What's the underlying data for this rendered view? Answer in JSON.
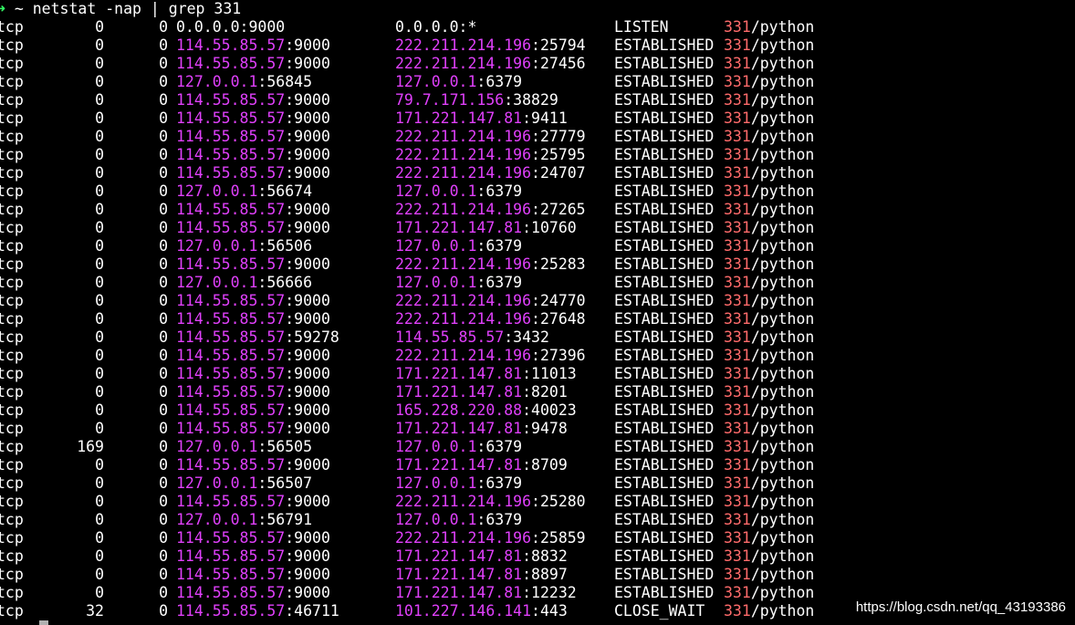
{
  "prompt": {
    "arrow": "➜",
    "cwd": "~",
    "command": "netstat -nap | grep 331"
  },
  "rows": [
    {
      "proto": "tcp",
      "recv": "0",
      "send": "0",
      "local_ip": "0.0.0.0",
      "local_port": "9000",
      "foreign_ip": "0.0.0.0",
      "foreign_port": "*",
      "state": "LISTEN",
      "pid": "331",
      "prog": "/python",
      "colored": false
    },
    {
      "proto": "tcp",
      "recv": "0",
      "send": "0",
      "local_ip": "114.55.85.57",
      "local_port": "9000",
      "foreign_ip": "222.211.214.196",
      "foreign_port": "25794",
      "state": "ESTABLISHED",
      "pid": "331",
      "prog": "/python",
      "colored": true
    },
    {
      "proto": "tcp",
      "recv": "0",
      "send": "0",
      "local_ip": "114.55.85.57",
      "local_port": "9000",
      "foreign_ip": "222.211.214.196",
      "foreign_port": "27456",
      "state": "ESTABLISHED",
      "pid": "331",
      "prog": "/python",
      "colored": true
    },
    {
      "proto": "tcp",
      "recv": "0",
      "send": "0",
      "local_ip": "127.0.0.1",
      "local_port": "56845",
      "foreign_ip": "127.0.0.1",
      "foreign_port": "6379",
      "state": "ESTABLISHED",
      "pid": "331",
      "prog": "/python",
      "colored": true
    },
    {
      "proto": "tcp",
      "recv": "0",
      "send": "0",
      "local_ip": "114.55.85.57",
      "local_port": "9000",
      "foreign_ip": "79.7.171.156",
      "foreign_port": "38829",
      "state": "ESTABLISHED",
      "pid": "331",
      "prog": "/python",
      "colored": true
    },
    {
      "proto": "tcp",
      "recv": "0",
      "send": "0",
      "local_ip": "114.55.85.57",
      "local_port": "9000",
      "foreign_ip": "171.221.147.81",
      "foreign_port": "9411",
      "state": "ESTABLISHED",
      "pid": "331",
      "prog": "/python",
      "colored": true
    },
    {
      "proto": "tcp",
      "recv": "0",
      "send": "0",
      "local_ip": "114.55.85.57",
      "local_port": "9000",
      "foreign_ip": "222.211.214.196",
      "foreign_port": "27779",
      "state": "ESTABLISHED",
      "pid": "331",
      "prog": "/python",
      "colored": true
    },
    {
      "proto": "tcp",
      "recv": "0",
      "send": "0",
      "local_ip": "114.55.85.57",
      "local_port": "9000",
      "foreign_ip": "222.211.214.196",
      "foreign_port": "25795",
      "state": "ESTABLISHED",
      "pid": "331",
      "prog": "/python",
      "colored": true
    },
    {
      "proto": "tcp",
      "recv": "0",
      "send": "0",
      "local_ip": "114.55.85.57",
      "local_port": "9000",
      "foreign_ip": "222.211.214.196",
      "foreign_port": "24707",
      "state": "ESTABLISHED",
      "pid": "331",
      "prog": "/python",
      "colored": true
    },
    {
      "proto": "tcp",
      "recv": "0",
      "send": "0",
      "local_ip": "127.0.0.1",
      "local_port": "56674",
      "foreign_ip": "127.0.0.1",
      "foreign_port": "6379",
      "state": "ESTABLISHED",
      "pid": "331",
      "prog": "/python",
      "colored": true
    },
    {
      "proto": "tcp",
      "recv": "0",
      "send": "0",
      "local_ip": "114.55.85.57",
      "local_port": "9000",
      "foreign_ip": "222.211.214.196",
      "foreign_port": "27265",
      "state": "ESTABLISHED",
      "pid": "331",
      "prog": "/python",
      "colored": true
    },
    {
      "proto": "tcp",
      "recv": "0",
      "send": "0",
      "local_ip": "114.55.85.57",
      "local_port": "9000",
      "foreign_ip": "171.221.147.81",
      "foreign_port": "10760",
      "state": "ESTABLISHED",
      "pid": "331",
      "prog": "/python",
      "colored": true
    },
    {
      "proto": "tcp",
      "recv": "0",
      "send": "0",
      "local_ip": "127.0.0.1",
      "local_port": "56506",
      "foreign_ip": "127.0.0.1",
      "foreign_port": "6379",
      "state": "ESTABLISHED",
      "pid": "331",
      "prog": "/python",
      "colored": true
    },
    {
      "proto": "tcp",
      "recv": "0",
      "send": "0",
      "local_ip": "114.55.85.57",
      "local_port": "9000",
      "foreign_ip": "222.211.214.196",
      "foreign_port": "25283",
      "state": "ESTABLISHED",
      "pid": "331",
      "prog": "/python",
      "colored": true
    },
    {
      "proto": "tcp",
      "recv": "0",
      "send": "0",
      "local_ip": "127.0.0.1",
      "local_port": "56666",
      "foreign_ip": "127.0.0.1",
      "foreign_port": "6379",
      "state": "ESTABLISHED",
      "pid": "331",
      "prog": "/python",
      "colored": true
    },
    {
      "proto": "tcp",
      "recv": "0",
      "send": "0",
      "local_ip": "114.55.85.57",
      "local_port": "9000",
      "foreign_ip": "222.211.214.196",
      "foreign_port": "24770",
      "state": "ESTABLISHED",
      "pid": "331",
      "prog": "/python",
      "colored": true
    },
    {
      "proto": "tcp",
      "recv": "0",
      "send": "0",
      "local_ip": "114.55.85.57",
      "local_port": "9000",
      "foreign_ip": "222.211.214.196",
      "foreign_port": "27648",
      "state": "ESTABLISHED",
      "pid": "331",
      "prog": "/python",
      "colored": true
    },
    {
      "proto": "tcp",
      "recv": "0",
      "send": "0",
      "local_ip": "114.55.85.57",
      "local_port": "59278",
      "foreign_ip": "114.55.85.57",
      "foreign_port": "3432",
      "state": "ESTABLISHED",
      "pid": "331",
      "prog": "/python",
      "colored": true
    },
    {
      "proto": "tcp",
      "recv": "0",
      "send": "0",
      "local_ip": "114.55.85.57",
      "local_port": "9000",
      "foreign_ip": "222.211.214.196",
      "foreign_port": "27396",
      "state": "ESTABLISHED",
      "pid": "331",
      "prog": "/python",
      "colored": true
    },
    {
      "proto": "tcp",
      "recv": "0",
      "send": "0",
      "local_ip": "114.55.85.57",
      "local_port": "9000",
      "foreign_ip": "171.221.147.81",
      "foreign_port": "11013",
      "state": "ESTABLISHED",
      "pid": "331",
      "prog": "/python",
      "colored": true
    },
    {
      "proto": "tcp",
      "recv": "0",
      "send": "0",
      "local_ip": "114.55.85.57",
      "local_port": "9000",
      "foreign_ip": "171.221.147.81",
      "foreign_port": "8201",
      "state": "ESTABLISHED",
      "pid": "331",
      "prog": "/python",
      "colored": true
    },
    {
      "proto": "tcp",
      "recv": "0",
      "send": "0",
      "local_ip": "114.55.85.57",
      "local_port": "9000",
      "foreign_ip": "165.228.220.88",
      "foreign_port": "40023",
      "state": "ESTABLISHED",
      "pid": "331",
      "prog": "/python",
      "colored": true
    },
    {
      "proto": "tcp",
      "recv": "0",
      "send": "0",
      "local_ip": "114.55.85.57",
      "local_port": "9000",
      "foreign_ip": "171.221.147.81",
      "foreign_port": "9478",
      "state": "ESTABLISHED",
      "pid": "331",
      "prog": "/python",
      "colored": true
    },
    {
      "proto": "tcp",
      "recv": "169",
      "send": "0",
      "local_ip": "127.0.0.1",
      "local_port": "56505",
      "foreign_ip": "127.0.0.1",
      "foreign_port": "6379",
      "state": "ESTABLISHED",
      "pid": "331",
      "prog": "/python",
      "colored": true
    },
    {
      "proto": "tcp",
      "recv": "0",
      "send": "0",
      "local_ip": "114.55.85.57",
      "local_port": "9000",
      "foreign_ip": "171.221.147.81",
      "foreign_port": "8709",
      "state": "ESTABLISHED",
      "pid": "331",
      "prog": "/python",
      "colored": true
    },
    {
      "proto": "tcp",
      "recv": "0",
      "send": "0",
      "local_ip": "127.0.0.1",
      "local_port": "56507",
      "foreign_ip": "127.0.0.1",
      "foreign_port": "6379",
      "state": "ESTABLISHED",
      "pid": "331",
      "prog": "/python",
      "colored": true
    },
    {
      "proto": "tcp",
      "recv": "0",
      "send": "0",
      "local_ip": "114.55.85.57",
      "local_port": "9000",
      "foreign_ip": "222.211.214.196",
      "foreign_port": "25280",
      "state": "ESTABLISHED",
      "pid": "331",
      "prog": "/python",
      "colored": true
    },
    {
      "proto": "tcp",
      "recv": "0",
      "send": "0",
      "local_ip": "127.0.0.1",
      "local_port": "56791",
      "foreign_ip": "127.0.0.1",
      "foreign_port": "6379",
      "state": "ESTABLISHED",
      "pid": "331",
      "prog": "/python",
      "colored": true
    },
    {
      "proto": "tcp",
      "recv": "0",
      "send": "0",
      "local_ip": "114.55.85.57",
      "local_port": "9000",
      "foreign_ip": "222.211.214.196",
      "foreign_port": "25859",
      "state": "ESTABLISHED",
      "pid": "331",
      "prog": "/python",
      "colored": true
    },
    {
      "proto": "tcp",
      "recv": "0",
      "send": "0",
      "local_ip": "114.55.85.57",
      "local_port": "9000",
      "foreign_ip": "171.221.147.81",
      "foreign_port": "8832",
      "state": "ESTABLISHED",
      "pid": "331",
      "prog": "/python",
      "colored": true
    },
    {
      "proto": "tcp",
      "recv": "0",
      "send": "0",
      "local_ip": "114.55.85.57",
      "local_port": "9000",
      "foreign_ip": "171.221.147.81",
      "foreign_port": "8897",
      "state": "ESTABLISHED",
      "pid": "331",
      "prog": "/python",
      "colored": true
    },
    {
      "proto": "tcp",
      "recv": "0",
      "send": "0",
      "local_ip": "114.55.85.57",
      "local_port": "9000",
      "foreign_ip": "171.221.147.81",
      "foreign_port": "12232",
      "state": "ESTABLISHED",
      "pid": "331",
      "prog": "/python",
      "colored": true
    },
    {
      "proto": "tcp",
      "recv": "32",
      "send": "0",
      "local_ip": "114.55.85.57",
      "local_port": "46711",
      "foreign_ip": "101.227.146.141",
      "foreign_port": "443",
      "state": "CLOSE_WAIT",
      "pid": "331",
      "prog": "/python",
      "colored": true
    }
  ],
  "watermark": "https://blog.csdn.net/qq_43193386",
  "colors": {
    "background": "#000000",
    "text": "#ffffff",
    "ip": "#e040fb",
    "pid": "#ff6b6b",
    "prompt_arrow": "#33ff66"
  }
}
